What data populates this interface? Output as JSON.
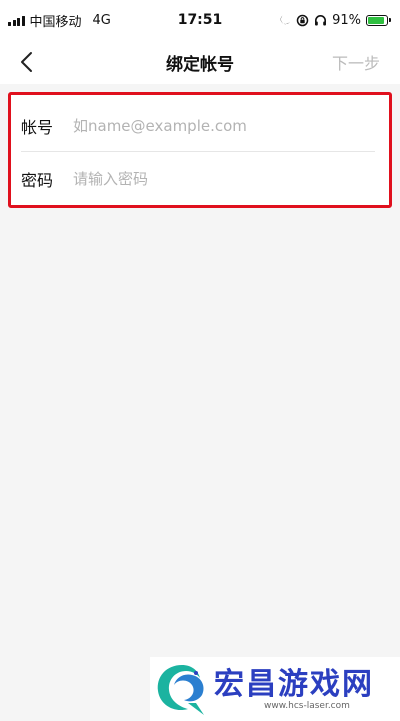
{
  "status_bar": {
    "carrier": "中国移动",
    "network": "4G",
    "time": "17:51",
    "battery": "91%",
    "battery_level": 0.91,
    "icons": [
      "signal-icon",
      "moon-icon",
      "lock-rotation-icon",
      "headphones-icon",
      "battery-charging-icon"
    ]
  },
  "nav": {
    "title": "绑定帐号",
    "next_label": "下一步",
    "back_icon": "chevron-left-icon"
  },
  "form": {
    "account_label": "帐号",
    "account_placeholder": "如name@example.com",
    "account_value": "",
    "password_label": "密码",
    "password_placeholder": "请输入密码",
    "password_value": ""
  },
  "watermark": {
    "title": "宏昌游戏网",
    "url": "www.hcs-laser.com"
  },
  "colors": {
    "highlight_border": "#e0101d",
    "next_disabled": "#bbbbbb",
    "placeholder": "#b3b3b3",
    "background": "#f5f5f5",
    "battery_green": "#2fbf40",
    "watermark_blue": "#2b3fc0",
    "watermark_teal": "#1bb3a0"
  }
}
